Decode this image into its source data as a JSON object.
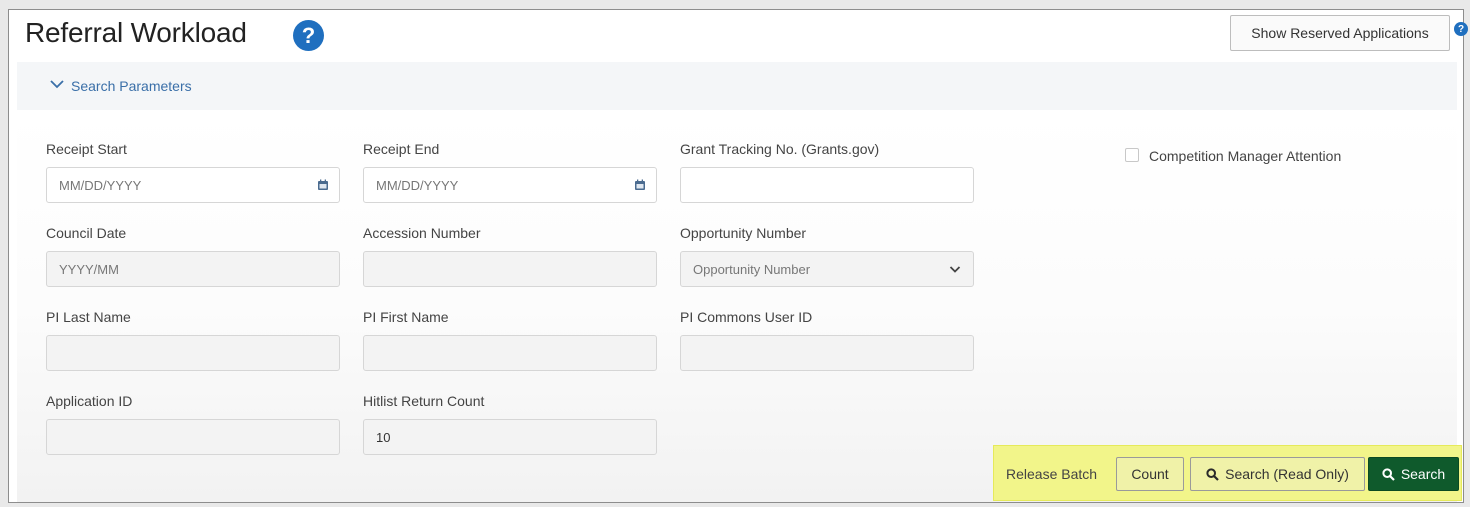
{
  "header": {
    "title": "Referral Workload",
    "help_icon": "question-circle-icon",
    "reserved_button_label": "Show Reserved Applications"
  },
  "search_parameters": {
    "label": "Search Parameters",
    "expanded": true
  },
  "fields": {
    "receipt_start": {
      "label": "Receipt Start",
      "placeholder": "MM/DD/YYYY",
      "value": ""
    },
    "receipt_end": {
      "label": "Receipt End",
      "placeholder": "MM/DD/YYYY",
      "value": ""
    },
    "grant_tracking": {
      "label": "Grant Tracking No. (Grants.gov)",
      "value": ""
    },
    "council_date": {
      "label": "Council Date",
      "placeholder": "YYYY/MM",
      "value": ""
    },
    "accession_number": {
      "label": "Accession Number",
      "value": ""
    },
    "opportunity_number": {
      "label": "Opportunity Number",
      "placeholder": "Opportunity Number",
      "value": ""
    },
    "pi_last_name": {
      "label": "PI Last Name",
      "value": ""
    },
    "pi_first_name": {
      "label": "PI First Name",
      "value": ""
    },
    "pi_commons_user_id": {
      "label": "PI Commons User ID",
      "value": ""
    },
    "application_id": {
      "label": "Application ID",
      "value": ""
    },
    "hitlist_return_count": {
      "label": "Hitlist Return Count",
      "value": "10"
    }
  },
  "competition_manager": {
    "label": "Competition Manager Attention",
    "checked": false
  },
  "actions": {
    "release_batch": "Release Batch",
    "count": "Count",
    "search_read_only": "Search (Read Only)",
    "search": "Search"
  },
  "colors": {
    "accent_blue": "#1f6fbf",
    "link_blue": "#3a6fa8",
    "search_green": "#0f5a2c",
    "highlight_yellow": "#f2f58a"
  }
}
